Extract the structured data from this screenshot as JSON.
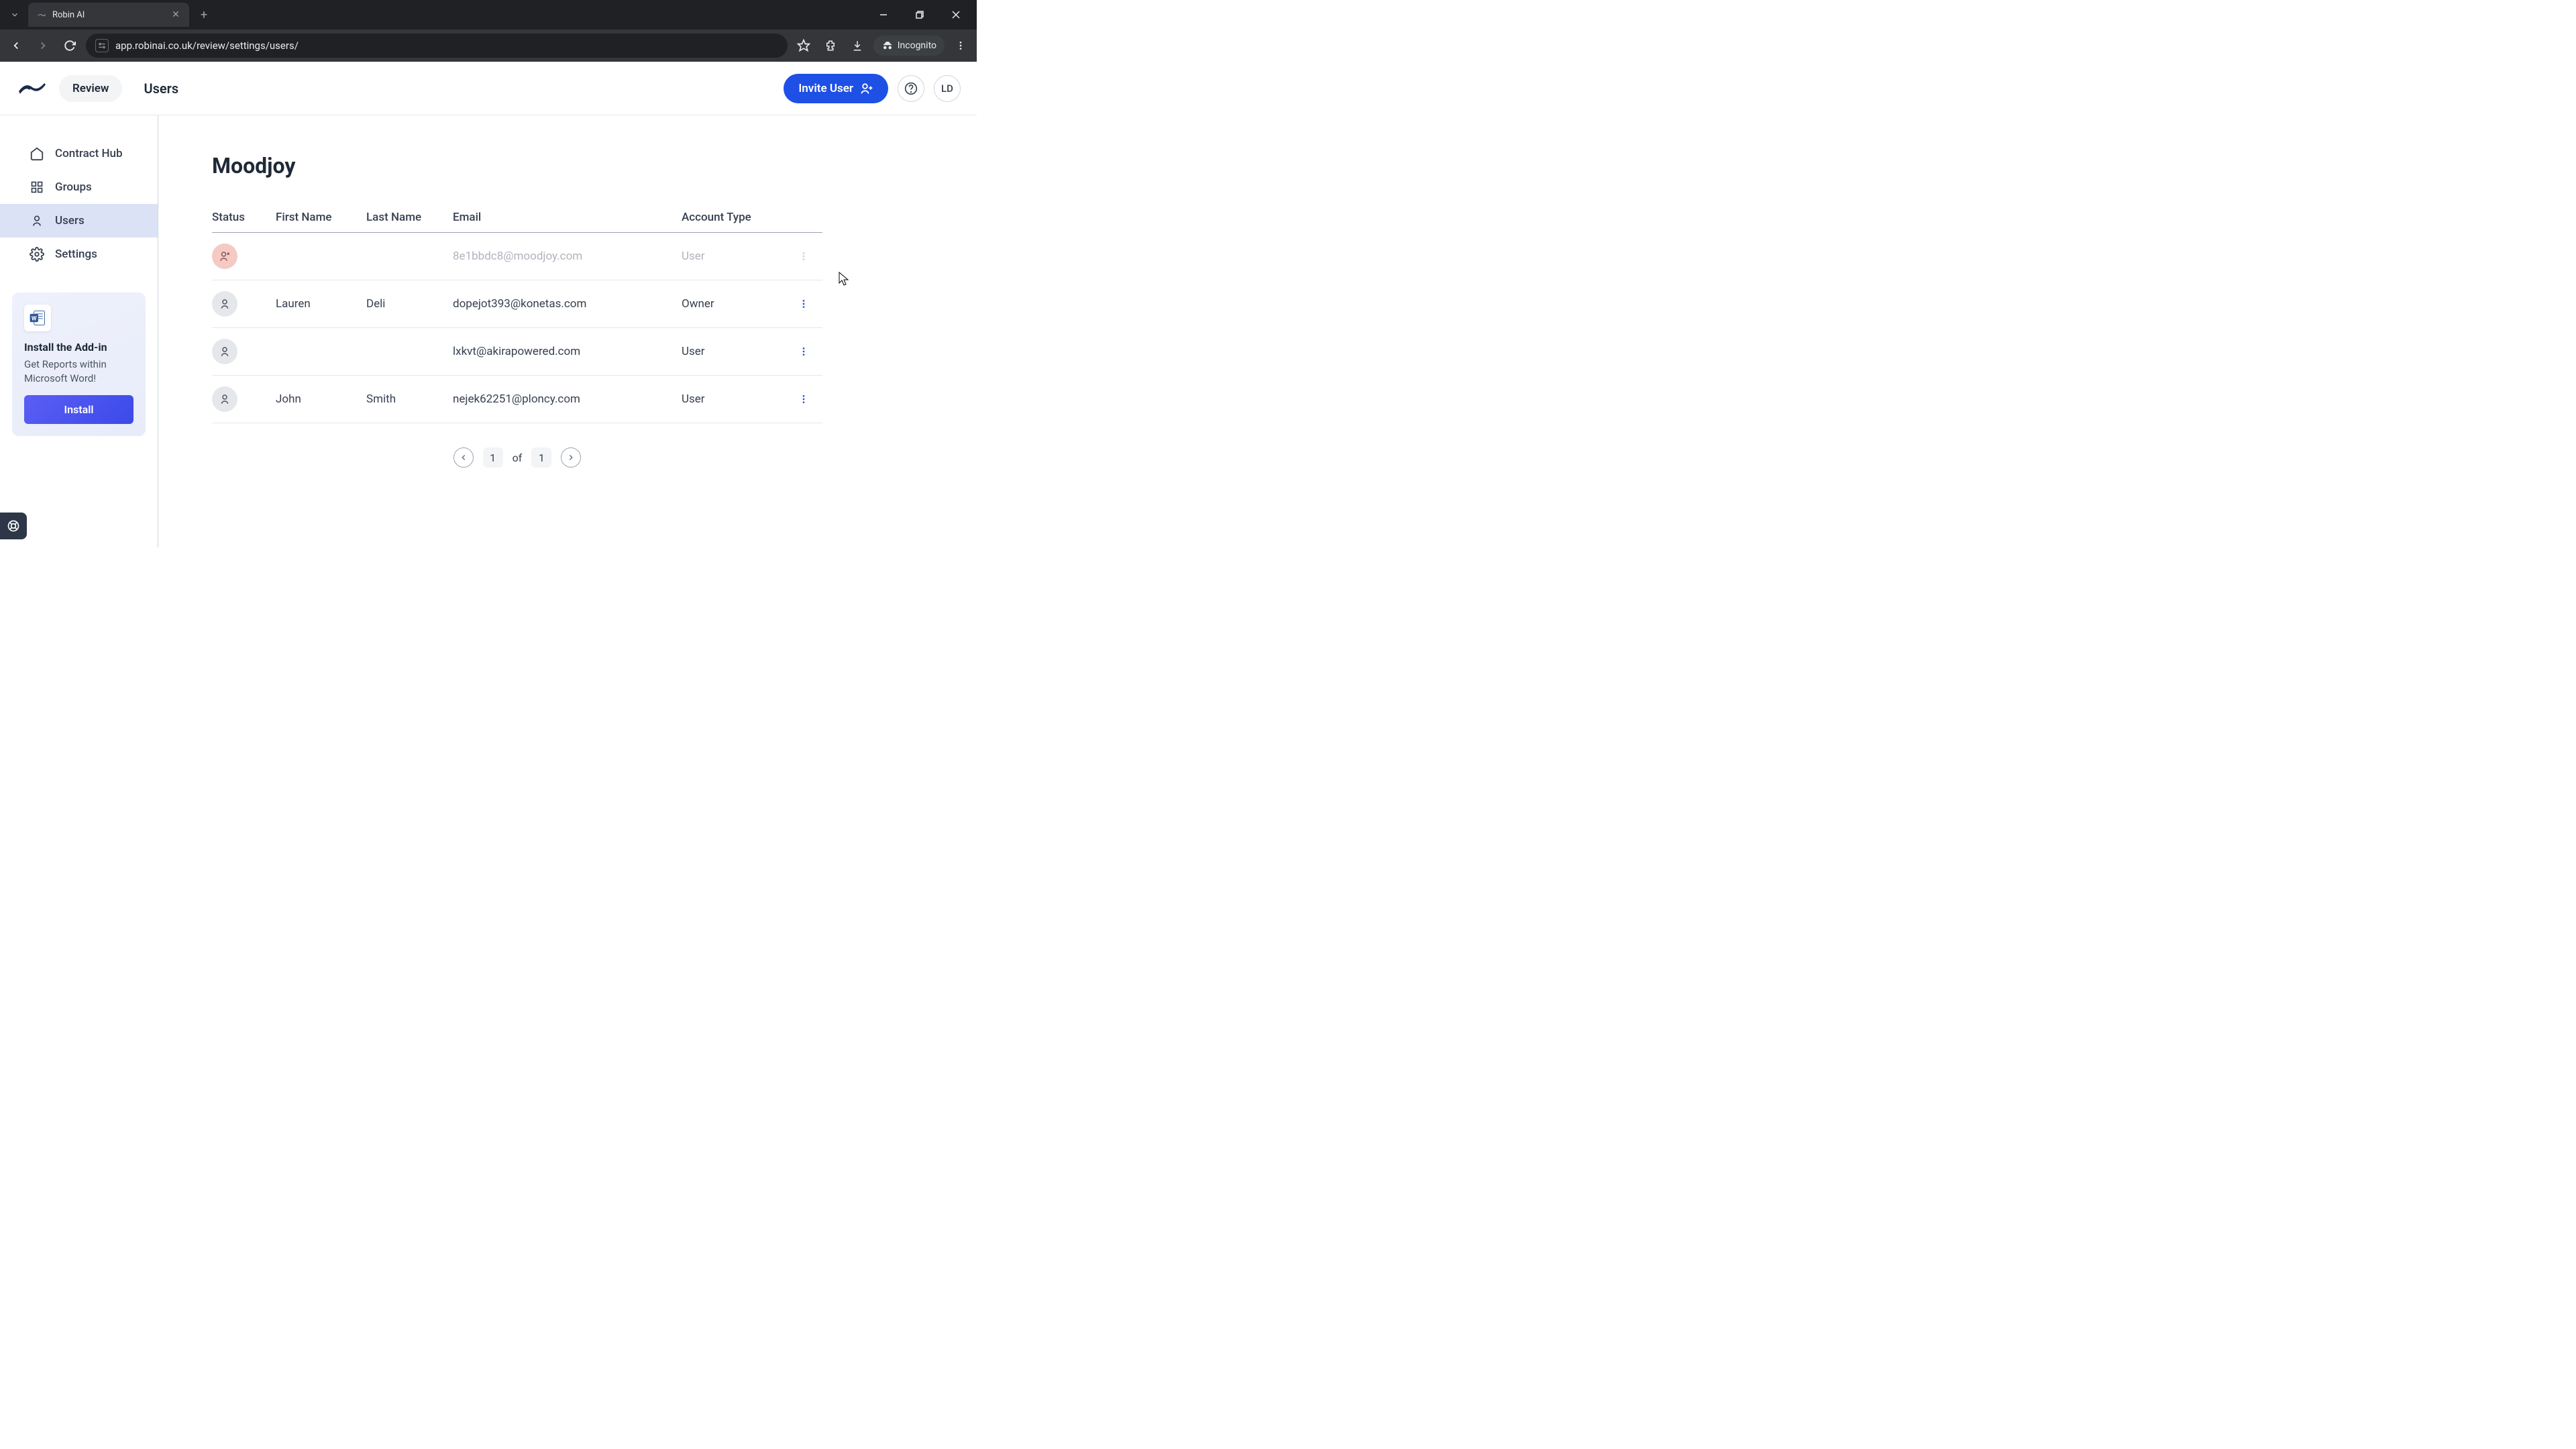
{
  "browser": {
    "tab_title": "Robin AI",
    "url": "app.robinai.co.uk/review/settings/users/",
    "incognito_label": "Incognito"
  },
  "header": {
    "review_label": "Review",
    "page_title": "Users",
    "invite_label": "Invite User",
    "avatar_initials": "LD"
  },
  "sidebar": {
    "items": [
      {
        "label": "Contract Hub"
      },
      {
        "label": "Groups"
      },
      {
        "label": "Users"
      },
      {
        "label": "Settings"
      }
    ],
    "promo": {
      "title": "Install the Add-in",
      "desc": "Get Reports within Microsoft Word!",
      "button": "Install"
    }
  },
  "content": {
    "org_title": "Moodjoy",
    "columns": {
      "status": "Status",
      "first": "First Name",
      "last": "Last Name",
      "email": "Email",
      "type": "Account Type"
    },
    "rows": [
      {
        "status": "pending",
        "first": "",
        "last": "",
        "email": "8e1bbdc8@moodjoy.com",
        "type": "User"
      },
      {
        "status": "active",
        "first": "Lauren",
        "last": "Deli",
        "email": "dopejot393@konetas.com",
        "type": "Owner"
      },
      {
        "status": "active",
        "first": "",
        "last": "",
        "email": "lxkvt@akirapowered.com",
        "type": "User"
      },
      {
        "status": "active",
        "first": "John",
        "last": "Smith",
        "email": "nejek62251@ploncy.com",
        "type": "User"
      }
    ],
    "pagination": {
      "current": "1",
      "of_label": "of",
      "total": "1"
    }
  }
}
